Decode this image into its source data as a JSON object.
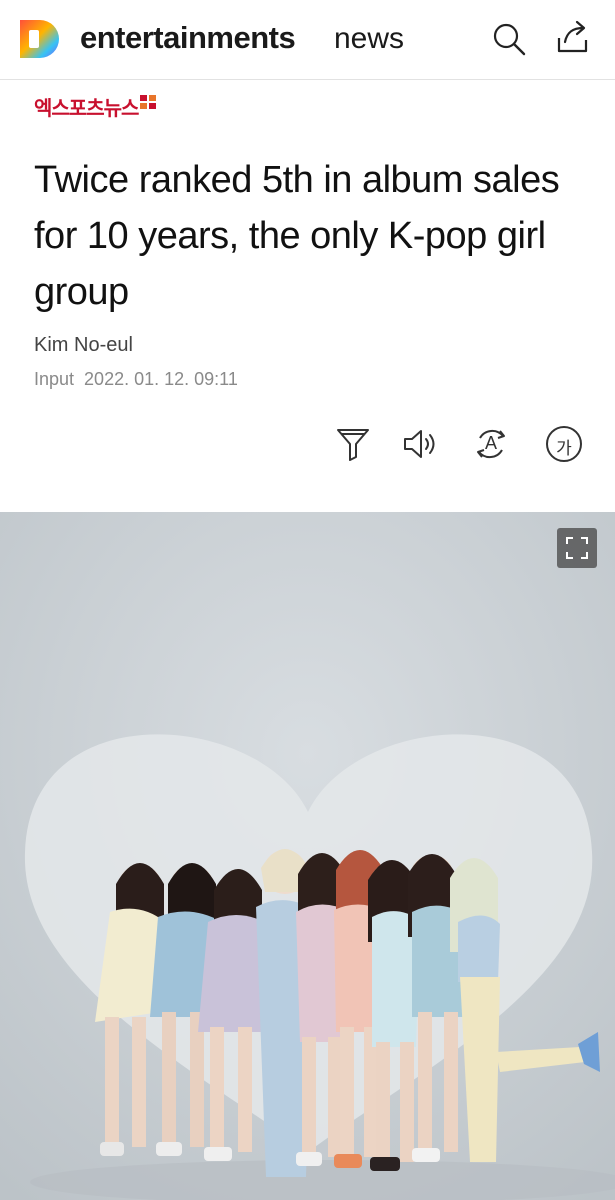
{
  "header": {
    "logo_letter": "D",
    "section_title": "entertainments",
    "section_sub": "news"
  },
  "article": {
    "press_name": "엑스포츠뉴스",
    "headline": "Twice ranked 5th in album sales for 10 years, the only K-pop girl group",
    "author": "Kim No-eul",
    "date_label": "Input",
    "date_value": "2022. 01. 12. 09:11"
  },
  "tools": {
    "translate_glyph": "A",
    "font_glyph": "가"
  },
  "icons": [
    "d-logo-icon",
    "search-icon",
    "share-icon",
    "filter-icon",
    "audio-icon",
    "translate-icon",
    "font-size-icon",
    "expand-icon"
  ],
  "colors": {
    "press_red": "#c8102e",
    "logo_gradient": [
      "#ff5a3c",
      "#ffb400",
      "#3cc8ff",
      "#7a5cff"
    ]
  }
}
